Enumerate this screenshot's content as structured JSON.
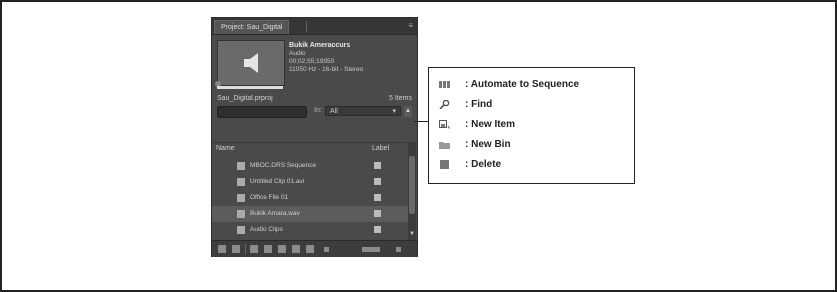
{
  "panel": {
    "tab_title": "Project: Sau_Digital",
    "menu_glyph": "≡",
    "clip": {
      "name": "Bukik Ameraccurs",
      "type": "Audio",
      "time": "00;02;55;19950",
      "details": "11050 Hz - 16-bit - Stereo"
    },
    "project_file": "Sau_Digital.prproj",
    "item_count": "5 Items",
    "in_label": "In:",
    "in_value": "All",
    "columns": {
      "name": "Name",
      "label": "Label"
    },
    "items": [
      {
        "name": "MBOC.DRS Sequence",
        "selected": false
      },
      {
        "name": "Untitled Clip 01.avi",
        "selected": false
      },
      {
        "name": "Office File 01",
        "selected": false
      },
      {
        "name": "Bukik Amara.wav",
        "selected": true
      },
      {
        "name": "Audio Clips",
        "selected": false
      }
    ]
  },
  "legend": {
    "items": [
      {
        "icon": "automate-to-sequence-icon",
        "label": ": Automate to Sequence"
      },
      {
        "icon": "find-icon",
        "label": ": Find"
      },
      {
        "icon": "new-item-icon",
        "label": ": New Item"
      },
      {
        "icon": "new-bin-icon",
        "label": ": New Bin"
      },
      {
        "icon": "delete-icon",
        "label": ": Delete"
      }
    ]
  }
}
